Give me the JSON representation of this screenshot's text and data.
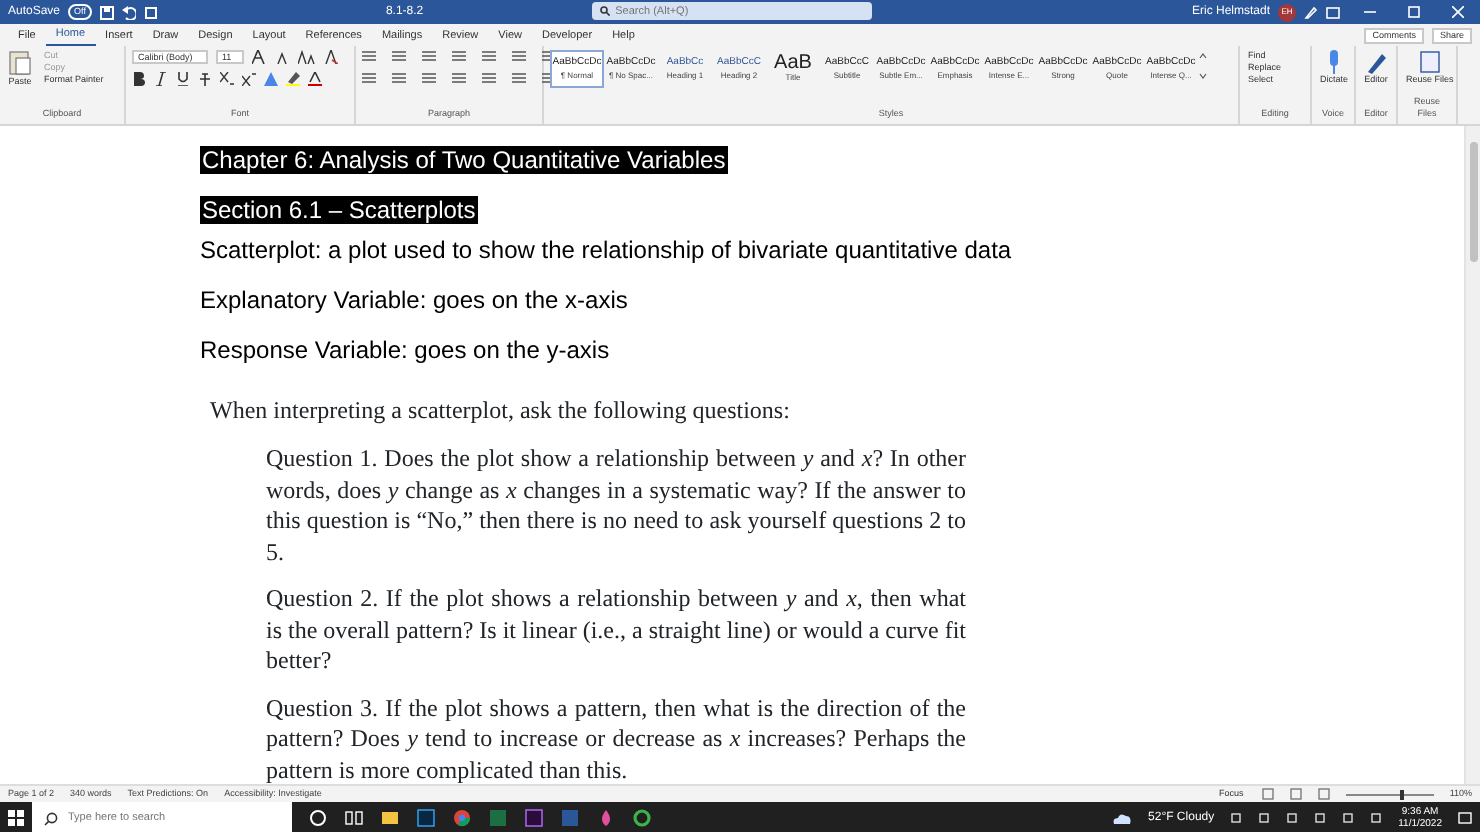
{
  "title_bar": {
    "autosave_label": "AutoSave",
    "autosave": {
      "label": "Off",
      "on": false
    },
    "document_title": "8.1-8.2",
    "search": {
      "placeholder": "Search (Alt+Q)"
    },
    "user_name": "Eric Helmstadt",
    "user_initials": "EH"
  },
  "ribbon_tabs": [
    {
      "label": "File",
      "selected": false
    },
    {
      "label": "Home",
      "selected": true
    },
    {
      "label": "Insert",
      "selected": false
    },
    {
      "label": "Draw",
      "selected": false
    },
    {
      "label": "Design",
      "selected": false
    },
    {
      "label": "Layout",
      "selected": false
    },
    {
      "label": "References",
      "selected": false
    },
    {
      "label": "Mailings",
      "selected": false
    },
    {
      "label": "Review",
      "selected": false
    },
    {
      "label": "View",
      "selected": false
    },
    {
      "label": "Developer",
      "selected": false
    },
    {
      "label": "Help",
      "selected": false
    }
  ],
  "ribbon_actions": [
    "Comments",
    "Share"
  ],
  "clipboard": {
    "paste": "Paste",
    "items": [
      "Cut",
      "Copy",
      "Format Painter"
    ],
    "group_label": "Clipboard"
  },
  "font": {
    "name": "Calibri (Body)",
    "size": "11",
    "group_label": "Font"
  },
  "paragraph": {
    "group_label": "Paragraph"
  },
  "styles": {
    "group_label": "Styles",
    "items": [
      {
        "preview": "AaBbCcDc",
        "name": "¶ Normal",
        "selected": true
      },
      {
        "preview": "AaBbCcDc",
        "name": "¶ No Spac...",
        "selected": false
      },
      {
        "preview": "AaBbCc",
        "name": "Heading 1",
        "selected": false
      },
      {
        "preview": "AaBbCcC",
        "name": "Heading 2",
        "selected": false
      },
      {
        "preview": "AaB",
        "name": "Title",
        "selected": false
      },
      {
        "preview": "AaBbCcC",
        "name": "Subtitle",
        "selected": false
      },
      {
        "preview": "AaBbCcDc",
        "name": "Subtle Em...",
        "selected": false
      },
      {
        "preview": "AaBbCcDc",
        "name": "Emphasis",
        "selected": false
      },
      {
        "preview": "AaBbCcDc",
        "name": "Intense E...",
        "selected": false
      },
      {
        "preview": "AaBbCcDc",
        "name": "Strong",
        "selected": false
      },
      {
        "preview": "AaBbCcDc",
        "name": "Quote",
        "selected": false
      },
      {
        "preview": "AaBbCcDc",
        "name": "Intense Q...",
        "selected": false
      }
    ]
  },
  "editing": {
    "items": [
      "Find",
      "Replace",
      "Select"
    ],
    "group_label": "Editing"
  },
  "voice": {
    "button": "Dictate",
    "group_label": "Voice"
  },
  "editor": {
    "button": "Editor",
    "group_label": "Editor"
  },
  "reuse_files": {
    "button": "Reuse Files",
    "group_label": "Reuse Files"
  },
  "document": {
    "blocks": [
      {
        "kind": "highlight",
        "text": "Chapter 6: Analysis of Two Quantitative Variables"
      },
      {
        "kind": "highlight",
        "text": "Section 6.1 – Scatterplots"
      },
      {
        "kind": "plain",
        "text": "Scatterplot: a plot used to show the relationship of bivariate quantitative data"
      },
      {
        "kind": "plain",
        "text": "Explanatory Variable: goes on the x-axis"
      },
      {
        "kind": "plain",
        "text": "Response Variable: goes on the y-axis"
      },
      {
        "kind": "serif",
        "text": "When interpreting a scatterplot, ask the following questions:"
      },
      {
        "kind": "question",
        "text": "Question 1. Does the plot show a relationship between *y* and *x*? In other words, does *y* change as *x* changes in a systematic way? If the answer to this question is “No,” then there is no need to ask yourself questions 2 to 5."
      },
      {
        "kind": "question",
        "text": "Question 2. If the plot shows a relationship between *y* and *x*, then what is the overall pattern? Is it linear (i.e., a straight line) or would a curve fit better?"
      },
      {
        "kind": "question",
        "text": "Question 3. If the plot shows a pattern, then what is the direction of the pattern? Does *y* tend to increase or decrease as *x* increases? Perhaps the pattern is more complicated than this."
      }
    ]
  },
  "status_bar": {
    "items": [
      "Page 1 of 2",
      "340 words",
      "Text Predictions: On",
      "Accessibility: Investigate"
    ],
    "focus": "Focus",
    "zoom": {
      "level": 0.62,
      "label": "110%"
    }
  },
  "taskbar": {
    "search_placeholder": "Type here to search",
    "weather": "52°F  Cloudy",
    "time": "9:36 AM",
    "date": "11/1/2022"
  }
}
